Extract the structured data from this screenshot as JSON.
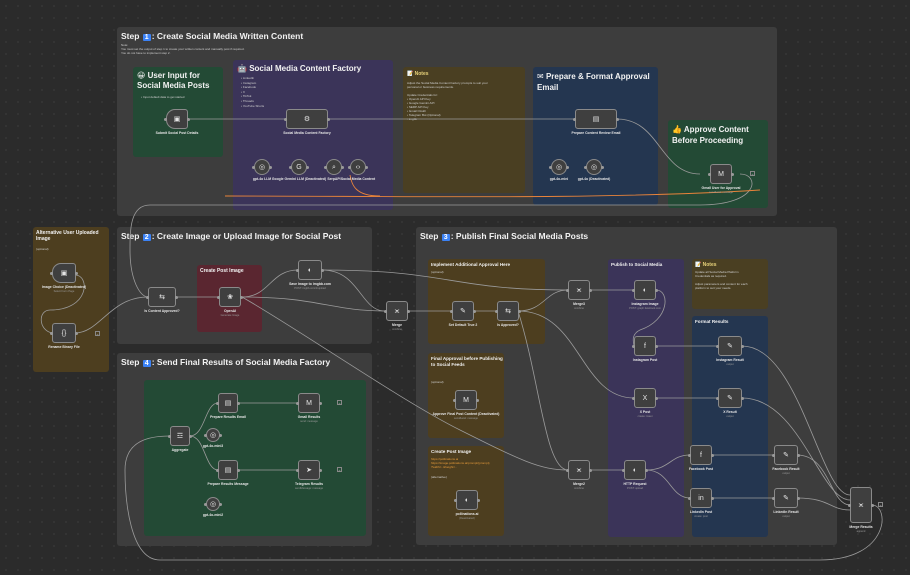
{
  "step1": {
    "prefix": "Step",
    "num": "1",
    "title": ": Create Social Media Written Content",
    "note": "Note:\nYou must set the output of step 1 to create your written content and manually post if required.\nYou do not have to implement step 2."
  },
  "user_input": {
    "title": "User Input for Social Media Posts",
    "note": "Input default data to get started"
  },
  "factory": {
    "title": "Social Media Content Factory",
    "platforms": [
      "LinkedIn",
      "Instagram",
      "Facebook",
      "X",
      "TikTok",
      "Threads",
      "YouTube Shorts"
    ]
  },
  "notes1": {
    "heading": "Notes",
    "body": "Adjust the Social Media Content Factory prompts to suit your\npersonal or business requirements.\n\nUpdate Credentials for:\n• OpenAI API Key\n• Google Gemini API\n• SERP API Key\n• Gmail OAuth\n• Telegram Bot (Optional)\n• imgbb"
  },
  "prepare": {
    "title": "Prepare & Format Approval Email"
  },
  "approve": {
    "title": "Approve Content Before Proceeding"
  },
  "alt": {
    "title": "Alternative User Uploaded Image",
    "sub": "(optional)"
  },
  "step2": {
    "prefix": "Step",
    "num": "2",
    "title": ": Create Image or Upload Image for Social Post"
  },
  "create_post_image": {
    "title": "Create Post Image"
  },
  "step3": {
    "prefix": "Step",
    "num": "3",
    "title": ": Publish Final Social Media Posts"
  },
  "impl": {
    "title": "Implement Additional Approval Here",
    "sub": "(optional)"
  },
  "final_approval": {
    "title": "Final Approval before Publishing to Social Feeds",
    "sub": "(optional)"
  },
  "create_post_image2": {
    "title": "Create Post Image",
    "sub": "(alternative)"
  },
  "publish": {
    "title": "Publish to Social Media"
  },
  "notes2": {
    "heading": "Notes",
    "body": "Update all Social Media Platform\nCredentials as required.\n\nAdjust parameters and content for each\nplatform to suit your needs."
  },
  "format_results": {
    "title": "Format Results"
  },
  "step4": {
    "prefix": "Step",
    "num": "4",
    "title": ": Send Final Results of Social Media Factory"
  },
  "nodes": {
    "submit": {
      "label": "Submit Social Post Details",
      "icon": "📄"
    },
    "factory_node": {
      "label": "Social Media Content Factory",
      "icon": "🤖"
    },
    "gpt1": {
      "label": "gpt-4o LLM"
    },
    "gemini": {
      "label": "Google Gemini LLM (Deactivated)"
    },
    "serp": {
      "label": "SerpAPI"
    },
    "smc": {
      "label": "Social Media Content"
    },
    "prep_email": {
      "label": "Prepare Content Review Email",
      "icon": "🧰"
    },
    "gpt_mini": {
      "label": "gpt-4o-mini"
    },
    "gpt_4o2": {
      "label": "gpt-4o (Deactivated)"
    },
    "gmail_approval": {
      "label": "Gmail User for Approval",
      "sub": "send&wait: message"
    },
    "is_approved": {
      "label": "Is Content Approved?"
    },
    "openai": {
      "label": "OpenAI",
      "sub": "Generate Image"
    },
    "save_imgbb": {
      "label": "Save Image to imgbb.com",
      "sub": "POST: imgbb.com/1/upload"
    },
    "merge": {
      "label": "Merge",
      "sub": "combine"
    },
    "set_default": {
      "label": "Set Default True 2"
    },
    "is_approved2": {
      "label": "Is Approved?"
    },
    "merge3": {
      "label": "Merge3",
      "sub": "combine"
    },
    "instagram_image": {
      "label": "Instagram Image",
      "sub": "POST: graph.facebook.com"
    },
    "instagram_post": {
      "label": "Instagram Post"
    },
    "x_post": {
      "label": "X Post",
      "sub": "create: tweet"
    },
    "facebook_post": {
      "label": "Facebook Post"
    },
    "linkedin_post": {
      "label": "LinkedIn Post",
      "sub": "create: post"
    },
    "approve_final": {
      "label": "Approve Final Post Content (Deactivated)",
      "sub": "send&wait: message"
    },
    "pollinations": {
      "label": "pollinations.ai",
      "sub": "(Deactivated)"
    },
    "merge2": {
      "label": "Merge2",
      "sub": "combine"
    },
    "http": {
      "label": "HTTP Request",
      "sub": "POST: upload"
    },
    "insta_result": {
      "label": "Instagram Result",
      "sub": "output"
    },
    "x_result": {
      "label": "X Result",
      "sub": "output"
    },
    "fb_result": {
      "label": "Facebook Result",
      "sub": "output"
    },
    "li_result": {
      "label": "LinkedIn Result",
      "sub": "output"
    },
    "merge_results": {
      "label": "Merge Results",
      "sub": "append"
    },
    "image_choice": {
      "label": "Image Choice (Deactivated)",
      "sub": "Select Form Page"
    },
    "rename_binary": {
      "label": "Rename Binary File"
    },
    "aggregate": {
      "label": "Aggregate"
    },
    "prep_results_email": {
      "label": "Prepare Results Email"
    },
    "gpt_mini3": {
      "label": "gpt-4o-mini3"
    },
    "gmail_results": {
      "label": "Gmail Results",
      "sub": "send: message"
    },
    "prep_results_msg": {
      "label": "Prepare Results Message"
    },
    "gpt_mini2": {
      "label": "gpt-4o-mini2"
    },
    "telegram": {
      "label": "Telegram Results",
      "sub": "sendMessage: message"
    }
  }
}
